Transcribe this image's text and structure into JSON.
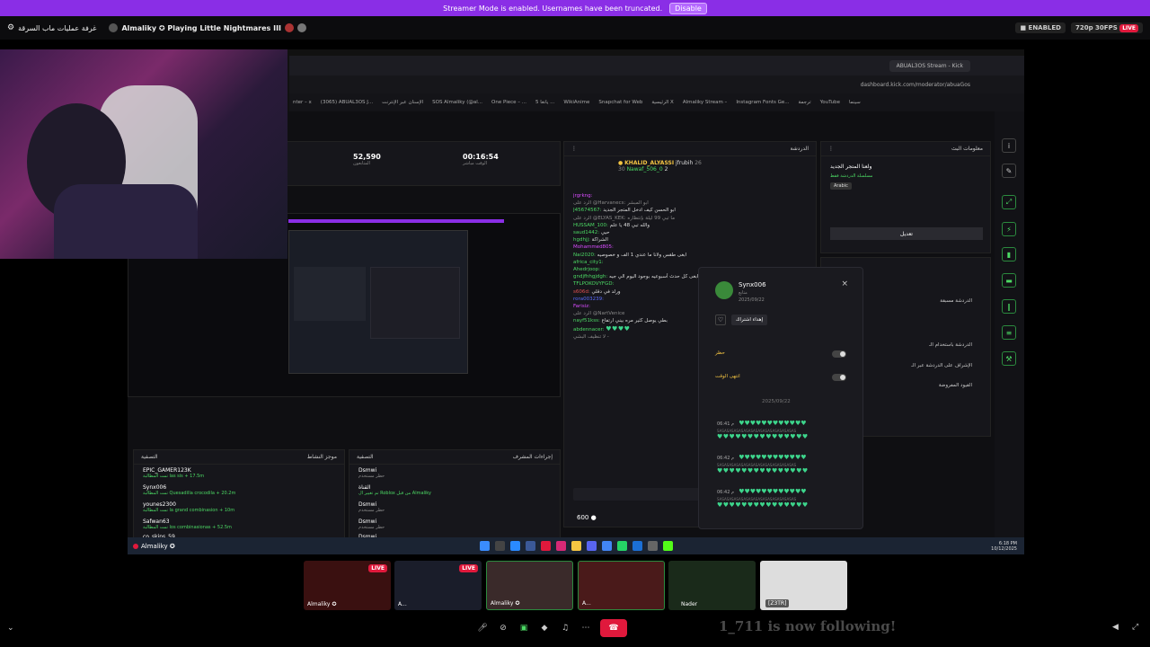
{
  "banner": {
    "text": "Streamer Mode is enabled. Usernames have been truncated.",
    "button": "Disable"
  },
  "topbar": {
    "left_label": "غرفة عمليات ماب السرقة",
    "stream_title": "Almaliky ✪ Playing Little Nightmares III",
    "enabled_badge": "ENABLED",
    "quality_badge": "720p 30FPS",
    "live_badge": "LIVE"
  },
  "browser": {
    "tabs": [
      "ABUAL3OS Stream - Kick"
    ],
    "url": "dashboard.kick.com/moderator/abuaGos",
    "bookmarks": [
      "nter – x",
      "(3065) ABUAL3OS J...",
      "الإسنان عبر الإنترنت",
      "SOS Almaliky (@al...",
      "One Piece – ...",
      "يانغا 5 ...",
      "WikiAnime",
      "Snapchat for Web",
      "الرئيسية X",
      "Almaliky Stream –",
      "Instagram Fonts Ge...",
      "ترجمة",
      "YouTube",
      "سينما"
    ]
  },
  "stats": {
    "followers": "52,590",
    "followers_label": "المتابعون",
    "uptime": "00:16:54",
    "uptime_label": "الوقت مباشر"
  },
  "chat": {
    "title": "الدردشة",
    "pinned_user": "KHALID_ALYASSI",
    "pinned_count": "30",
    "pinned_user2": "jfrubih",
    "pinned_count2": "26",
    "pinned_user3": "Nawaf_506_0",
    "pinned_count3": "2",
    "lines": [
      {
        "user": "jrgrkng:",
        "msg": "",
        "color": "#d94cff"
      },
      {
        "user": "",
        "msg": "الرد على @Harvanecs: ابو المبشر",
        "color": "#888"
      },
      {
        "user": "J45674567:",
        "msg": "ابو الحسن كيف ادخل المتجر الجديد",
        "color": "#4cd964"
      },
      {
        "user": "",
        "msg": "الرد على @ELYAS_KEK: ما تبي 99 ليلة بإنتظاره",
        "color": "#888"
      },
      {
        "user": "HUSSAM_100:",
        "msg": "والله تبي 48 يا علم",
        "color": "#4cd964"
      },
      {
        "user": "saud1442:",
        "msg": "حيي",
        "color": "#4cd964"
      },
      {
        "user": "hgdhjj:",
        "msg": "الشراكة",
        "color": "#4cd964"
      },
      {
        "user": "Mohammed805:",
        "msg": "",
        "color": "#d94cff"
      },
      {
        "user": "Nai2020:",
        "msg": "ابغى طقس ولانا ما عندي 1 الف و خصوصيه",
        "color": "#4cd964"
      },
      {
        "user": "africa_city1:",
        "msg": "",
        "color": "#4cd964"
      },
      {
        "user": "Ahedrjoop:",
        "msg": "",
        "color": "#4cd964"
      },
      {
        "user": "gndjfhhgjdgh:",
        "msg": "ابغى كل حدث أسبوعيه بوجود اليوم الي جيه",
        "color": "#4cd964"
      },
      {
        "user": "TFLPOKOVYFGD:",
        "msg": "",
        "color": "#4cd964"
      },
      {
        "user": "s606d:",
        "msg": "ورلد في دقلي",
        "color": "#e05050"
      },
      {
        "user": "rora003239:",
        "msg": "",
        "color": "#5a6cff"
      },
      {
        "user": "Farisiz:",
        "msg": "",
        "color": "#d94cff"
      },
      {
        "user": "",
        "msg": "الرد على @NartVenice",
        "color": "#888"
      },
      {
        "user": "nayf51kss:",
        "msg": "بطي يوصل كثير مره بيني ارتفاع",
        "color": "#4cd964"
      },
      {
        "user": "abdennacer:",
        "msg": "",
        "color": "#4cd964"
      },
      {
        "user": "",
        "msg": "لا تنظيف البشي -",
        "color": "#888"
      }
    ],
    "points": "600"
  },
  "mod_actions": {
    "title": "إجراءات المشرف",
    "items": [
      {
        "user": "Dsmwi",
        "action": "حظر مستخدم",
        "time": "قبل 19 ساعة"
      },
      {
        "user": "القناة",
        "action": "تم تغيير ال Roblox من قبل Almaliky",
        "time": "قبل 19 ساعة"
      },
      {
        "user": "Dsmwi",
        "action": "حظر مستخدم",
        "time": "قبل 19 ساعة"
      },
      {
        "user": "Dsmwi",
        "action": "حظر مستخدم",
        "time": "قبل 19 ساعة"
      },
      {
        "user": "Dsmwi",
        "action": "",
        "time": ""
      }
    ]
  },
  "activity": {
    "title": "موجز النشاط",
    "filter": "التصفية",
    "items": [
      {
        "user": "EPIC_GAMER123K",
        "desc": "تمت المطالبة las sis + 17.5m",
        "time": "قبل 4 دقائق"
      },
      {
        "user": "Synx006",
        "desc": "تمت المطالبة Quesadilla crocodila + 20.2m",
        "time": "قبل 4 دقائق"
      },
      {
        "user": "younes2300",
        "desc": "تمت المطالبة la grand combinasion + 10m",
        "time": "قبل 4 دقائق"
      },
      {
        "user": "Safwan63",
        "desc": "تمت المطالبة los combinasionas + 52.5m",
        "time": "قبل 4 دقائق"
      },
      {
        "user": "co_skins_59",
        "desc": "",
        "time": ""
      }
    ]
  },
  "stream_info": {
    "title": "معلومات البث",
    "stream_name": "ولعنا المتجر الجديد",
    "category": "مسلسلة الدردشة فقط",
    "language": "Arabic",
    "edit_button": "تعديل"
  },
  "settings": {
    "items": [
      "الدردشة مسبقة",
      "الدردشة باستخدام الـ",
      "الإشراف على الدردشة عبر الـ",
      "القيود المفروضة"
    ]
  },
  "popup": {
    "username": "Synx006",
    "subtitle": "متابع",
    "date": "2025/09/22",
    "gift_button": "إهداء اشتراك",
    "ban_label": "حظر",
    "timeout_label": "انتهى الوقت",
    "msg_date": "2025/09/22",
    "messages": [
      {
        "time": "06:41 م",
        "text": "SASASASASASASASASASASASASASASASAS"
      },
      {
        "time": "06:42 م",
        "text": "SASASASASASASASASASASASASASASASAS"
      },
      {
        "time": "06:42 م",
        "text": "SASASASASASASASASASASASASASASASAS"
      }
    ]
  },
  "taskbar": {
    "user": "Almaliky ✪",
    "time": "6:18 PM",
    "date": "10/12/2025"
  },
  "thumbs": [
    {
      "label": "Almaliky ✪",
      "live": "LIVE"
    },
    {
      "label": "A...",
      "live": "LIVE"
    },
    {
      "label": "Almaliky ✪",
      "live": ""
    },
    {
      "label": "A...",
      "live": ""
    },
    {
      "label": "Nader",
      "live": ""
    },
    {
      "label": "[Z3TR]",
      "live": ""
    }
  ],
  "follow_text": "1_711 is now following!",
  "colors": {
    "accent_purple": "#8a2ee6",
    "kick_green": "#53fc18",
    "live_red": "#e0193c"
  }
}
